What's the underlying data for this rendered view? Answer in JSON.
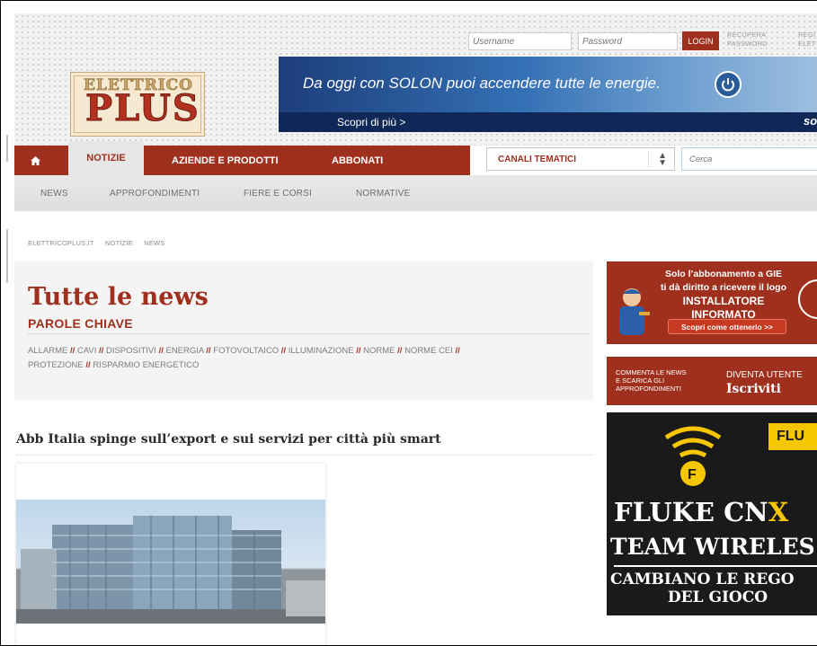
{
  "header": {
    "username_placeholder": "Username",
    "password_placeholder": "Password",
    "login_label": "LOGIN",
    "recover_password_label": "RECUPERA\nPASSWORD",
    "register_label": "REGI\nELET",
    "logo_top": "ELETTRICO",
    "logo_bottom": "PLUS"
  },
  "banner": {
    "headline": "Da oggi con SOLON puoi accendere tutte le energie.",
    "cta": "Scopri di più  >",
    "brand": "so"
  },
  "nav": {
    "home_icon": "home-icon",
    "items": [
      "NOTIZIE",
      "AZIENDE E PRODOTTI",
      "ABBONATI"
    ],
    "channels_select": "CANALI TEMATICI",
    "search_placeholder": "Cerca"
  },
  "subnav": {
    "items": [
      "NEWS",
      "APPROFONDIMENTI",
      "FIERE E CORSI",
      "NORMATIVE"
    ]
  },
  "breadcrumb": [
    "ELETTRICOPLUS.IT",
    "NOTIZIE",
    "NEWS"
  ],
  "main": {
    "title": "Tutte le news",
    "keywords_title": "PAROLE CHIAVE",
    "keywords": [
      "ALLARME",
      "CAVI",
      "DISPOSITIVI",
      "ENERGIA",
      "FOTOVOLTAICO",
      "ILLUMINAZIONE",
      "NORME",
      "NORME CEI",
      "PROTEZIONE",
      "RISPARMIO ENERGETICO"
    ],
    "keyword_separator": "//"
  },
  "article": {
    "title": "Abb Italia spinge sull’export e sui servizi per città più smart"
  },
  "ads": {
    "gie": {
      "line1": "Solo l’abbonamento a GIE",
      "line2": "ti dà diritto a ricevere il logo",
      "line3": "INSTALLATORE INFORMATO",
      "cta": "Scopri come ottenerlo >>"
    },
    "register": {
      "left": "COMMENTA LE NEWS\nE SCARICA GLI\nAPPROFONDIMENTI",
      "right_top": "DIVENTA UTENTE",
      "right_big": "Iscriviti"
    },
    "fluke": {
      "brand": "FLU",
      "line1_a": "FLUKE CN",
      "line1_b": "X",
      "line2": "TEAM WIRELES",
      "line3": "CAMBIANO LE REGO",
      "line4": "DEL GIOCO"
    }
  },
  "colors": {
    "brand_red": "#a0301e",
    "fluke_yellow": "#f6c600"
  }
}
